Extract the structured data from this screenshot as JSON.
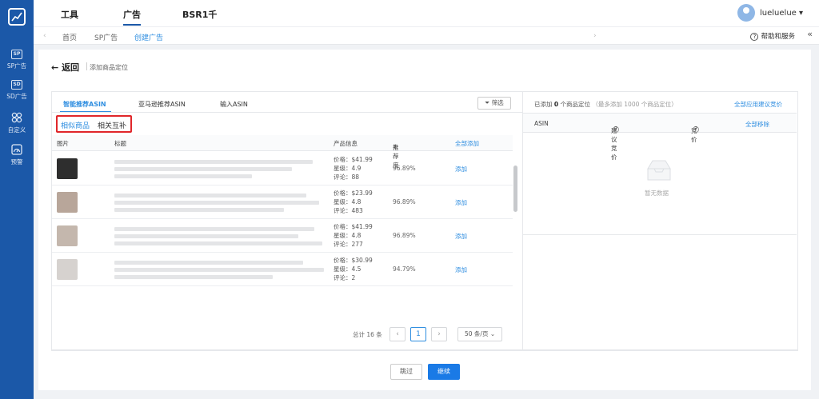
{
  "sidebar": {
    "items": [
      {
        "badge": "SP",
        "label": "SP广告"
      },
      {
        "badge": "SD",
        "label": "SD广告"
      },
      {
        "badge": "",
        "label": "自定义"
      },
      {
        "badge": "",
        "label": "预警"
      }
    ]
  },
  "header": {
    "tabs": [
      "工具",
      "广告",
      "BSR1千"
    ],
    "active_tab": "广告",
    "user": "lueluelue"
  },
  "breadcrumb": [
    "首页",
    "SP广告",
    "创建广告"
  ],
  "help_label": "帮助和服务",
  "page": {
    "back_label": "返回",
    "subtitle": "添加商品定位"
  },
  "left": {
    "tabs": [
      "智能推荐ASIN",
      "亚马逊推荐ASIN",
      "输入ASIN"
    ],
    "filter_label": "筛选",
    "subtabs": [
      "相似商品",
      "相关互补"
    ],
    "columns": {
      "image": "图片",
      "title": "标题",
      "info": "产品信息",
      "rec": "推荐度",
      "add_all": "全部添加"
    },
    "rows": [
      {
        "price": "价格：$41.99",
        "rating": "星级：4.9",
        "reviews": "评论：88",
        "rec": "96.89%",
        "action": "添加"
      },
      {
        "price": "价格：$23.99",
        "rating": "星级：4.8",
        "reviews": "评论：483",
        "rec": "96.89%",
        "action": "添加"
      },
      {
        "price": "价格：$41.99",
        "rating": "星级：4.8",
        "reviews": "评论：277",
        "rec": "96.89%",
        "action": "添加"
      },
      {
        "price": "价格：$30.99",
        "rating": "星级：4.5",
        "reviews": "评论：2",
        "rec": "94.79%",
        "action": "添加"
      }
    ],
    "pagination": {
      "total": "总计 16 条",
      "current": "1",
      "page_size": "50 条/页"
    }
  },
  "right": {
    "status_prefix": "已添加",
    "added_count": "0",
    "status_suffix": "个商品定位",
    "limit_note": "（最多添加 1000 个商品定位）",
    "apply_all": "全部应用建议竞价",
    "columns": {
      "asin": "ASIN",
      "suggested": "建议竞价",
      "bid": "竞价",
      "remove_all": "全部移除"
    },
    "empty_text": "暂无数据"
  },
  "footer": {
    "skip": "跳过",
    "continue": "继续"
  },
  "colors": {
    "sidebar": "#1b58a8",
    "accent": "#2f8ee0",
    "highlight": "#e0262a",
    "primary_button": "#1a7ae6"
  }
}
